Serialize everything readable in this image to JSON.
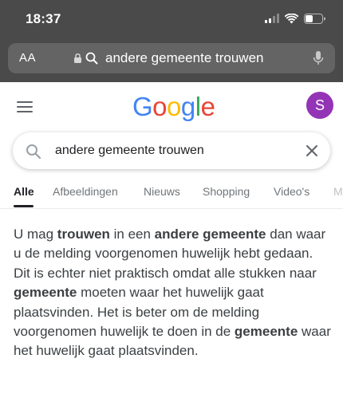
{
  "status_bar": {
    "time": "18:37"
  },
  "url_bar": {
    "text_size_label": "AA",
    "url_text": "andere gemeente trouwen"
  },
  "google": {
    "logo_letters": [
      {
        "char": "G",
        "color": "#4285F4"
      },
      {
        "char": "o",
        "color": "#EA4335"
      },
      {
        "char": "o",
        "color": "#FBBC05"
      },
      {
        "char": "g",
        "color": "#4285F4"
      },
      {
        "char": "l",
        "color": "#34A853"
      },
      {
        "char": "e",
        "color": "#EA4335"
      }
    ],
    "avatar_initial": "S",
    "avatar_color": "#9334b6"
  },
  "search": {
    "query": "andere gemeente trouwen"
  },
  "tabs": [
    {
      "label": "Alle",
      "active": true
    },
    {
      "label": "Afbeeldingen",
      "active": false
    },
    {
      "label": "Nieuws",
      "active": false
    },
    {
      "label": "Shopping",
      "active": false
    },
    {
      "label": "Video's",
      "active": false
    },
    {
      "label": "M",
      "active": false
    }
  ],
  "snippet": {
    "segments": [
      {
        "text": "U mag ",
        "bold": false
      },
      {
        "text": "trouwen",
        "bold": true
      },
      {
        "text": " in een ",
        "bold": false
      },
      {
        "text": "andere gemeente",
        "bold": true
      },
      {
        "text": " dan waar u de melding voorgenomen huwelijk hebt gedaan. Dit is echter niet praktisch omdat alle stukken naar ",
        "bold": false
      },
      {
        "text": "gemeente",
        "bold": true
      },
      {
        "text": " moeten waar het huwelijk gaat plaatsvinden. Het is beter om de melding voorgenomen huwelijk te doen in de ",
        "bold": false
      },
      {
        "text": "gemeente",
        "bold": true
      },
      {
        "text": " waar het huwelijk gaat plaatsvinden.",
        "bold": false
      }
    ]
  }
}
